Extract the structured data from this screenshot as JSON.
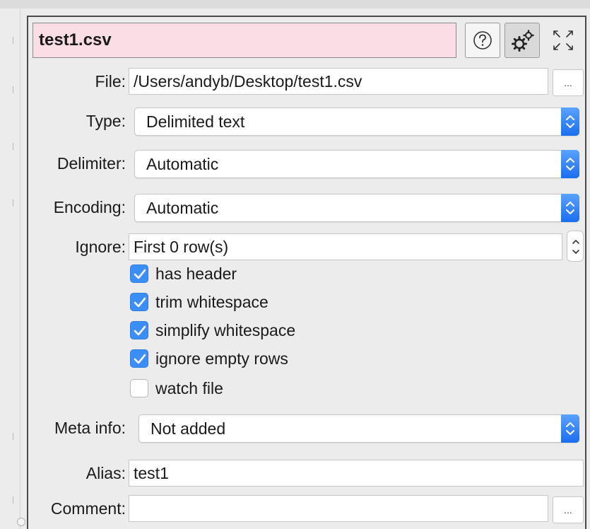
{
  "header": {
    "title": "test1.csv",
    "title_bg": "#fbdde5",
    "help_icon": "question-circle-icon",
    "settings_icon": "gears-icon",
    "expand_icon": "expand-arrows-icon"
  },
  "file": {
    "label": "File:",
    "value": "/Users/andyb/Desktop/test1.csv",
    "browse": "..."
  },
  "type": {
    "label": "Type:",
    "value": "Delimited text"
  },
  "delimiter": {
    "label": "Delimiter:",
    "value": "Automatic"
  },
  "encoding": {
    "label": "Encoding:",
    "value": "Automatic"
  },
  "ignore": {
    "label": "Ignore:",
    "value": "First 0 row(s)"
  },
  "options": [
    {
      "label": "has header",
      "checked": true
    },
    {
      "label": "trim whitespace",
      "checked": true
    },
    {
      "label": "simplify whitespace",
      "checked": true
    },
    {
      "label": "ignore empty rows",
      "checked": true
    },
    {
      "label": "watch file",
      "checked": false
    }
  ],
  "meta": {
    "label": "Meta info:",
    "value": "Not added"
  },
  "alias": {
    "label": "Alias:",
    "value": "test1"
  },
  "comment": {
    "label": "Comment:",
    "value": "",
    "browse": "..."
  },
  "accent": "#3b8ef5"
}
